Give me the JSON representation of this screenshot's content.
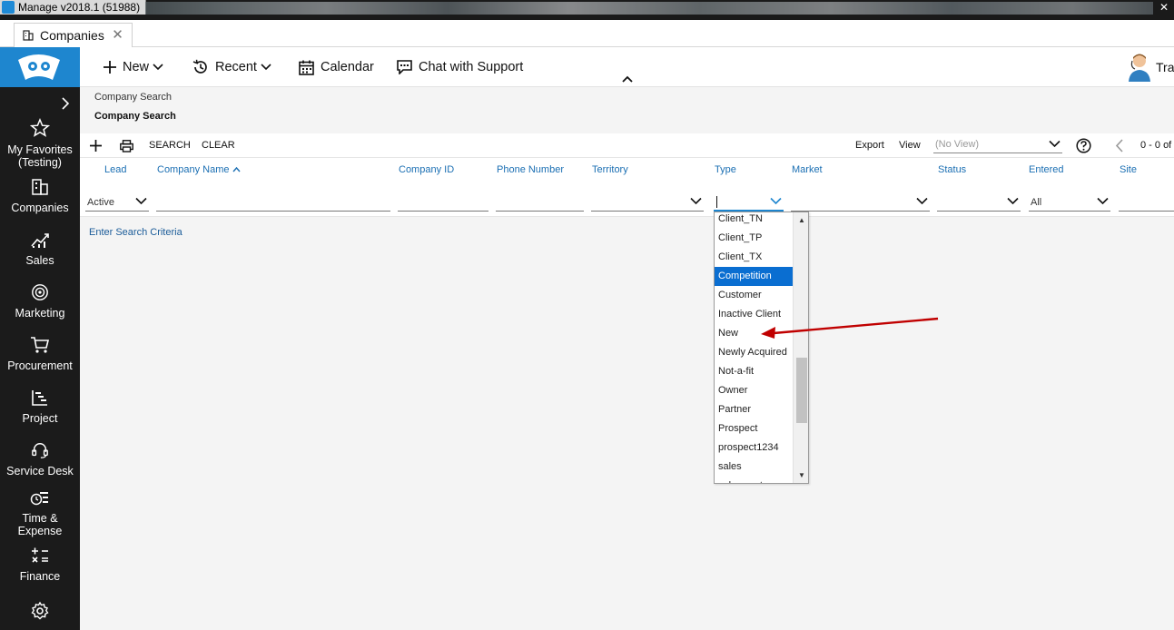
{
  "window": {
    "title": "Manage v2018.1 (51988)"
  },
  "doc_tab": {
    "label": "Companies",
    "close": "✕"
  },
  "toolbar": {
    "new_label": "New",
    "recent_label": "Recent",
    "calendar_label": "Calendar",
    "chat_label": "Chat with Support",
    "user_name": "Tra"
  },
  "sidebar": {
    "items": [
      {
        "label": "My Favorites (Testing)",
        "icon": "star-icon"
      },
      {
        "label": "Companies",
        "icon": "building-icon"
      },
      {
        "label": "Sales",
        "icon": "chart-icon"
      },
      {
        "label": "Marketing",
        "icon": "target-icon"
      },
      {
        "label": "Procurement",
        "icon": "cart-icon"
      },
      {
        "label": "Project",
        "icon": "gantt-icon"
      },
      {
        "label": "Service Desk",
        "icon": "headset-icon"
      },
      {
        "label": "Time & Expense",
        "icon": "clock-list-icon"
      },
      {
        "label": "Finance",
        "icon": "calculator-icon"
      },
      {
        "label": "",
        "icon": "gear-icon"
      }
    ]
  },
  "breadcrumb": {
    "parent": "Company Search",
    "current": "Company Search"
  },
  "searchbar": {
    "search_label": "SEARCH",
    "clear_label": "CLEAR",
    "export_label": "Export",
    "view_label": "View",
    "view_value": "(No View)",
    "paging": "0 - 0 of"
  },
  "columns": [
    "Lead",
    "Company Name",
    "Company ID",
    "Phone Number",
    "Territory",
    "Type",
    "Market",
    "Status",
    "Entered",
    "Site"
  ],
  "sort_indicator": "^",
  "filters": {
    "lead": "Active",
    "entered": "All"
  },
  "message": "Enter Search Criteria",
  "type_dropdown": {
    "options": [
      "Client_TN",
      "Client_TP",
      "Client_TX",
      "Competition",
      "Customer",
      "Inactive Client",
      "New",
      "Newly Acquired",
      "Not-a-fit",
      "Owner",
      "Partner",
      "Prospect",
      "prospect1234",
      "sales",
      "sales customer"
    ],
    "selected": "Competition"
  },
  "colors": {
    "accent": "#1e86cf",
    "sidebar": "#1b1b1b",
    "link": "#1b6fb3",
    "selection": "#0a6ed1",
    "annotation": "#c00000"
  }
}
